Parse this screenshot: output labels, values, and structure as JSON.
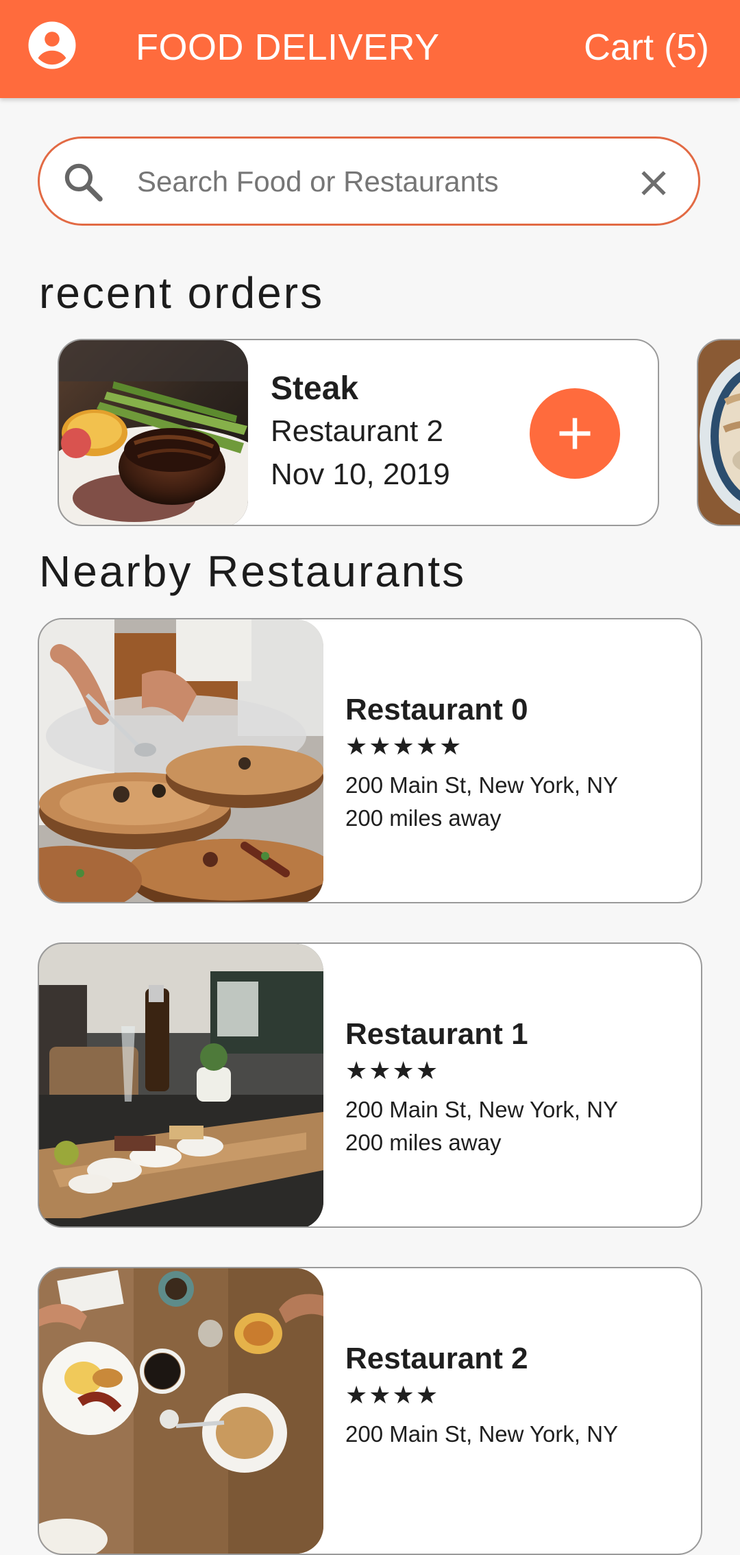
{
  "app_bar": {
    "title": "FOOD DELIVERY",
    "cart_label": "Cart (5)",
    "account_icon": "account-circle-icon",
    "color": "#ff6b3d"
  },
  "search": {
    "placeholder": "Search Food or Restaurants",
    "value": "",
    "search_icon": "search-icon",
    "clear_icon": "close-icon",
    "border_color": "#e26a44"
  },
  "recent": {
    "title": "recent orders",
    "orders": [
      {
        "name": "Steak",
        "restaurant": "Restaurant 2",
        "date": "Nov 10, 2019",
        "image": "steak-photo",
        "action_icon": "plus-icon"
      }
    ]
  },
  "nearby": {
    "title": "Nearby Restaurants",
    "restaurants": [
      {
        "name": "Restaurant 0",
        "stars": "★★★★★",
        "rating": 5,
        "address": "200 Main St, New York, NY",
        "distance": "200 miles away",
        "image": "chef-plating-photo"
      },
      {
        "name": "Restaurant 1",
        "stars": "★★★★",
        "rating": 4,
        "address": "200 Main St, New York, NY",
        "distance": "200 miles away",
        "image": "charcuterie-board-photo"
      },
      {
        "name": "Restaurant 2",
        "stars": "★★★★",
        "rating": 4,
        "address": "200 Main St, New York, NY",
        "distance": "",
        "image": "breakfast-table-photo"
      }
    ]
  }
}
